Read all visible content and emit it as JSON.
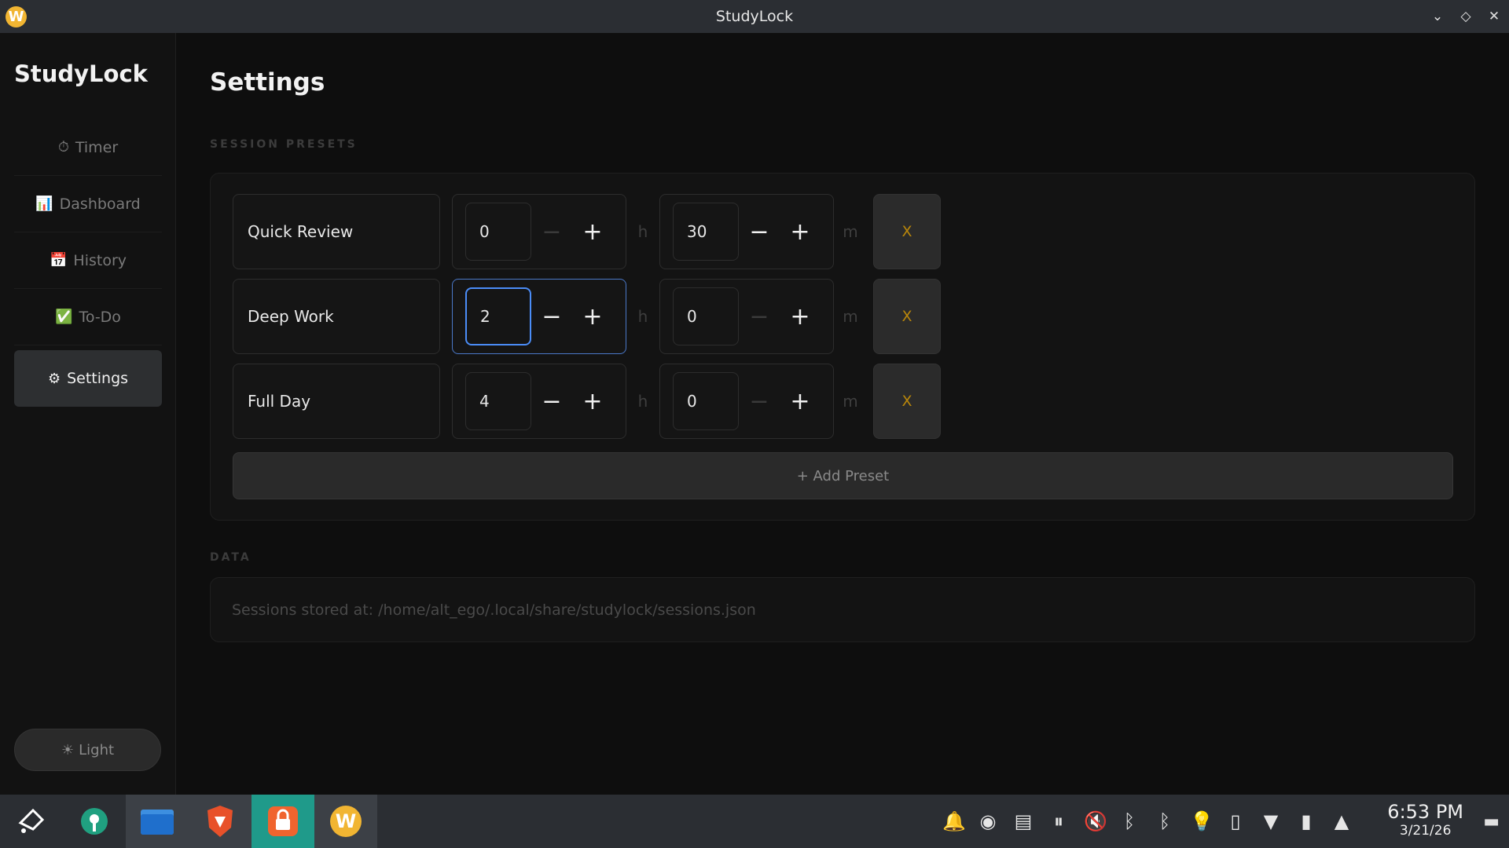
{
  "window": {
    "title": "StudyLock",
    "app_icon_letter": "W"
  },
  "window_controls": {
    "minimize": "⌄",
    "maximize": "◇",
    "close": "✕"
  },
  "sidebar": {
    "brand": "StudyLock",
    "items": [
      {
        "icon": "⏱",
        "label": "Timer"
      },
      {
        "icon": "📊",
        "label": "Dashboard"
      },
      {
        "icon": "📅",
        "label": "History"
      },
      {
        "icon": "✅",
        "label": "To-Do"
      },
      {
        "icon": "⚙",
        "label": "Settings"
      }
    ],
    "theme_toggle": {
      "icon": "☀",
      "label": "Light"
    }
  },
  "main": {
    "title": "Settings",
    "presets_section_label": "SESSION PRESETS",
    "presets": [
      {
        "name": "Quick Review",
        "hours": "0",
        "minutes": "30"
      },
      {
        "name": "Deep Work",
        "hours": "2",
        "minutes": "0"
      },
      {
        "name": "Full Day",
        "hours": "4",
        "minutes": "0"
      }
    ],
    "hours_unit": "h",
    "minutes_unit": "m",
    "delete_label": "X",
    "minus_label": "−",
    "plus_label": "+",
    "add_preset_label": "+ Add Preset",
    "data_section_label": "DATA",
    "sessions_path_text": "Sessions stored at: /home/alt_ego/.local/share/studylock/sessions.json"
  },
  "taskbar": {
    "clock_time": "6:53 PM",
    "clock_date": "3/21/26"
  }
}
